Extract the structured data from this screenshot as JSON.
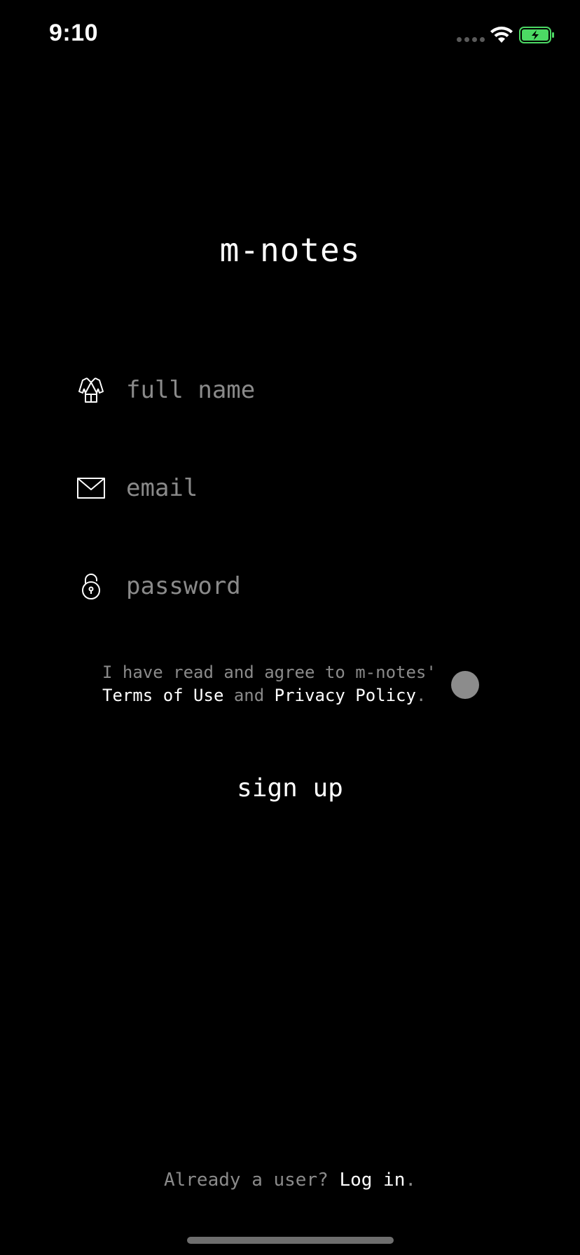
{
  "status_bar": {
    "time": "9:10",
    "battery_color": "#4cd964"
  },
  "app": {
    "title": "m-notes"
  },
  "form": {
    "full_name": {
      "placeholder": "full name",
      "value": "",
      "icon": "robe-icon"
    },
    "email": {
      "placeholder": "email",
      "value": "",
      "icon": "envelope-icon"
    },
    "password": {
      "placeholder": "password",
      "value": "",
      "icon": "lock-icon"
    }
  },
  "terms": {
    "prefix": "I have read and agree to m-notes'",
    "terms_link": "Terms of Use",
    "and": "and",
    "privacy_link": "Privacy Policy",
    "suffix": ".",
    "agreed": false
  },
  "signup_button": "sign up",
  "login": {
    "prompt": "Already a user?",
    "link": "Log in",
    "suffix": "."
  }
}
